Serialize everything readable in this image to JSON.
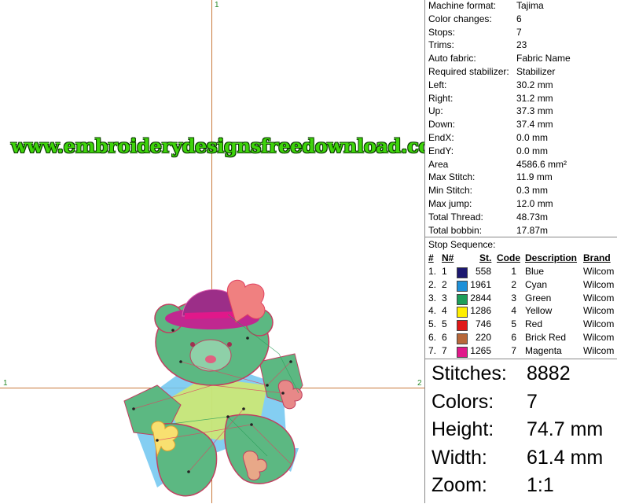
{
  "canvas": {
    "axis_labels": {
      "top": "1",
      "left": "1",
      "right": "2"
    },
    "watermark": "www.embroiderydesignsfreedownload.com"
  },
  "info": [
    {
      "key": "Machine format:",
      "value": "Tajima"
    },
    {
      "key": "Color changes:",
      "value": "6"
    },
    {
      "key": "Stops:",
      "value": "7"
    },
    {
      "key": "Trims:",
      "value": "23"
    },
    {
      "key": "Auto fabric:",
      "value": "Fabric Name"
    },
    {
      "key": "Required stabilizer:",
      "value": "Stabilizer"
    },
    {
      "key": "Left:",
      "value": "30.2 mm"
    },
    {
      "key": "Right:",
      "value": "31.2 mm"
    },
    {
      "key": "Up:",
      "value": "37.3 mm"
    },
    {
      "key": "Down:",
      "value": "37.4 mm"
    },
    {
      "key": "EndX:",
      "value": "0.0 mm"
    },
    {
      "key": "EndY:",
      "value": "0.0 mm"
    },
    {
      "key": "Area",
      "value": "4586.6 mm²"
    },
    {
      "key": "Max Stitch:",
      "value": "11.9 mm"
    },
    {
      "key": "Min Stitch:",
      "value": "0.3 mm"
    },
    {
      "key": "Max jump:",
      "value": "12.0 mm"
    },
    {
      "key": "Total Thread:",
      "value": "48.73m"
    },
    {
      "key": "Total bobbin:",
      "value": "17.87m"
    }
  ],
  "stop_sequence": {
    "title": "Stop Sequence:",
    "headers": {
      "num": "#",
      "n": "N#",
      "st": "St.",
      "code": "Code",
      "desc": "Description",
      "brand": "Brand"
    },
    "rows": [
      {
        "num": "1.",
        "n": "1",
        "color": "#1c1870",
        "st": "558",
        "code": "1",
        "desc": "Blue",
        "brand": "Wilcom"
      },
      {
        "num": "2.",
        "n": "2",
        "color": "#1e90d8",
        "st": "1961",
        "code": "2",
        "desc": "Cyan",
        "brand": "Wilcom"
      },
      {
        "num": "3.",
        "n": "3",
        "color": "#1e9e5a",
        "st": "2844",
        "code": "3",
        "desc": "Green",
        "brand": "Wilcom"
      },
      {
        "num": "4.",
        "n": "4",
        "color": "#ffee00",
        "st": "1286",
        "code": "4",
        "desc": "Yellow",
        "brand": "Wilcom"
      },
      {
        "num": "5.",
        "n": "5",
        "color": "#e01818",
        "st": "746",
        "code": "5",
        "desc": "Red",
        "brand": "Wilcom"
      },
      {
        "num": "6.",
        "n": "6",
        "color": "#b8683a",
        "st": "220",
        "code": "6",
        "desc": "Brick Red",
        "brand": "Wilcom"
      },
      {
        "num": "7.",
        "n": "7",
        "color": "#e0188a",
        "st": "1265",
        "code": "7",
        "desc": "Magenta",
        "brand": "Wilcom"
      }
    ]
  },
  "summary": [
    {
      "key": "Stitches:",
      "value": "8882"
    },
    {
      "key": "Colors:",
      "value": "7"
    },
    {
      "key": "Height:",
      "value": "74.7 mm"
    },
    {
      "key": "Width:",
      "value": "61.4 mm"
    },
    {
      "key": "Zoom:",
      "value": "1:1"
    }
  ]
}
